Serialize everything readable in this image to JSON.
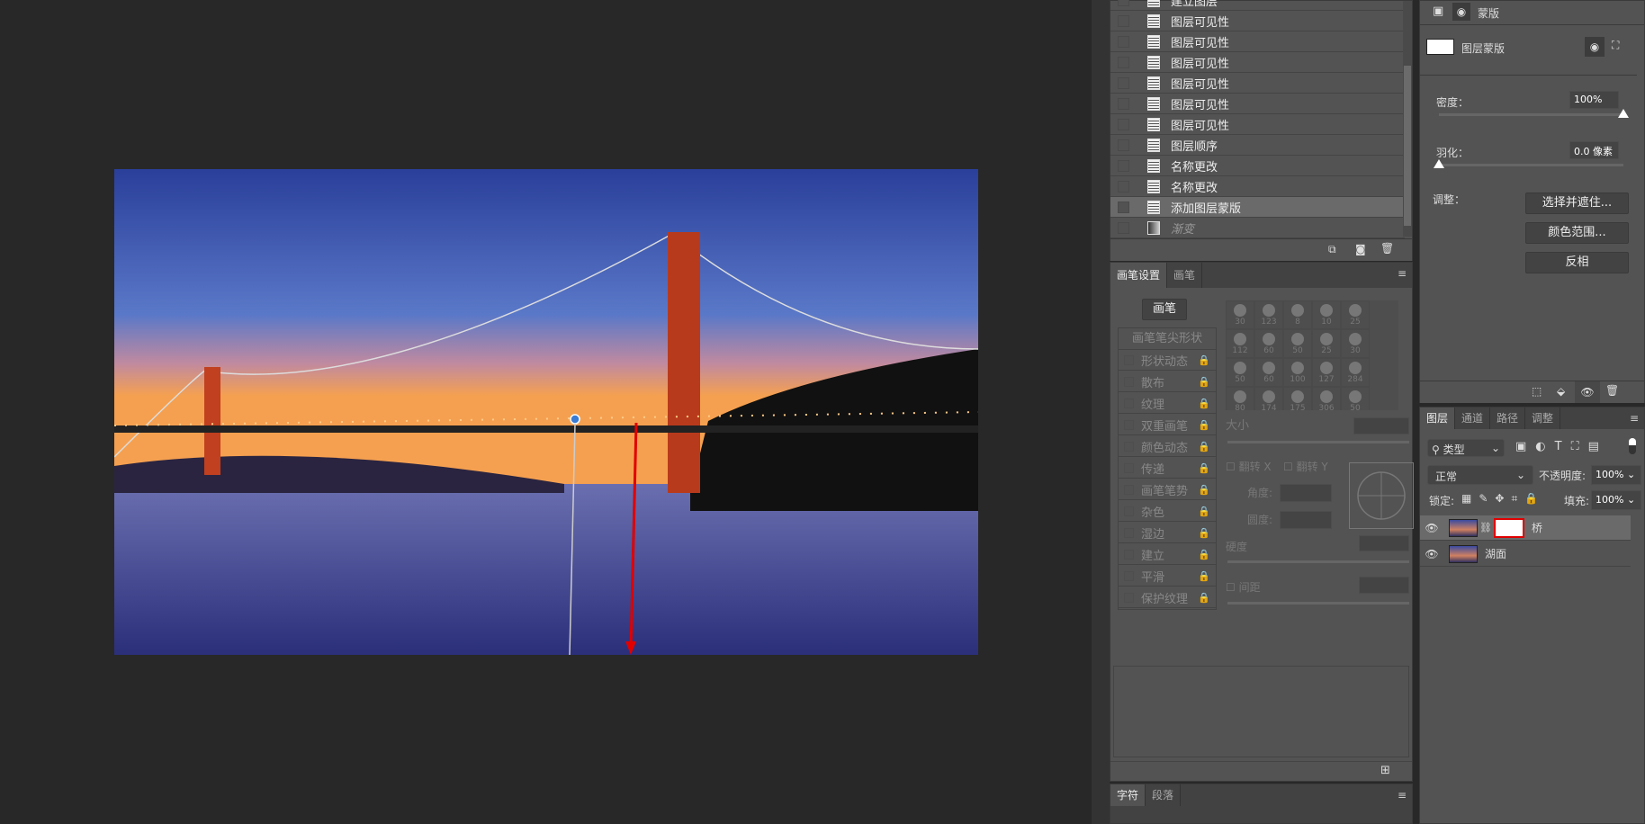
{
  "history": {
    "items": [
      {
        "label": "建立图层",
        "state": "normal"
      },
      {
        "label": "图层可见性",
        "state": "normal"
      },
      {
        "label": "图层可见性",
        "state": "normal"
      },
      {
        "label": "图层可见性",
        "state": "normal"
      },
      {
        "label": "图层可见性",
        "state": "normal"
      },
      {
        "label": "图层可见性",
        "state": "normal"
      },
      {
        "label": "图层可见性",
        "state": "normal"
      },
      {
        "label": "图层顺序",
        "state": "normal"
      },
      {
        "label": "名称更改",
        "state": "normal"
      },
      {
        "label": "名称更改",
        "state": "normal"
      },
      {
        "label": "添加图层蒙版",
        "state": "selected"
      },
      {
        "label": "渐变",
        "state": "ghost"
      }
    ],
    "icons": [
      "new-document-icon",
      "camera-icon",
      "trash-icon"
    ]
  },
  "brush": {
    "tabs": [
      "画笔设置",
      "画笔"
    ],
    "brush_button": "画笔",
    "tip_shape": "画笔笔尖形状",
    "options": [
      "形状动态",
      "散布",
      "纹理",
      "双重画笔",
      "颜色动态",
      "传递",
      "画笔笔势",
      "杂色",
      "湿边",
      "建立",
      "平滑",
      "保护纹理"
    ],
    "presets": [
      "30",
      "123",
      "8",
      "10",
      "25",
      "112",
      "60",
      "50",
      "25",
      "30",
      "50",
      "60",
      "100",
      "127",
      "284",
      "80",
      "174",
      "175",
      "306",
      "50"
    ],
    "size_label": "大小",
    "flip_x": "翻转 X",
    "flip_y": "翻转 Y",
    "angle_label": "角度:",
    "roundness_label": "圆度:",
    "hardness_label": "硬度",
    "spacing_label": "间距"
  },
  "text_panel": {
    "tabs": [
      "字符",
      "段落"
    ]
  },
  "properties": {
    "title": "蒙版",
    "mask_label": "图层蒙版",
    "density_label": "密度：",
    "density_value": "100%",
    "density_fraction": 1.0,
    "feather_label": "羽化：",
    "feather_value": "0.0 像素",
    "feather_fraction": 0.0,
    "adjust_label": "调整：",
    "buttons": [
      "选择并遮住...",
      "颜色范围...",
      "反相"
    ]
  },
  "layers": {
    "tabs": [
      "图层",
      "通道",
      "路径",
      "调整"
    ],
    "filter": "类型",
    "blend_mode": "正常",
    "opacity_label": "不透明度:",
    "opacity": "100%",
    "lock_label": "锁定:",
    "fill_label": "填充:",
    "fill": "100%",
    "items": [
      {
        "name": "桥",
        "selected": true,
        "has_mask": true
      },
      {
        "name": "湖面",
        "selected": false,
        "has_mask": false
      }
    ]
  },
  "colors": {
    "accent_red": "#e00000",
    "selection": "#6a6a6a",
    "panel": "#535353"
  }
}
